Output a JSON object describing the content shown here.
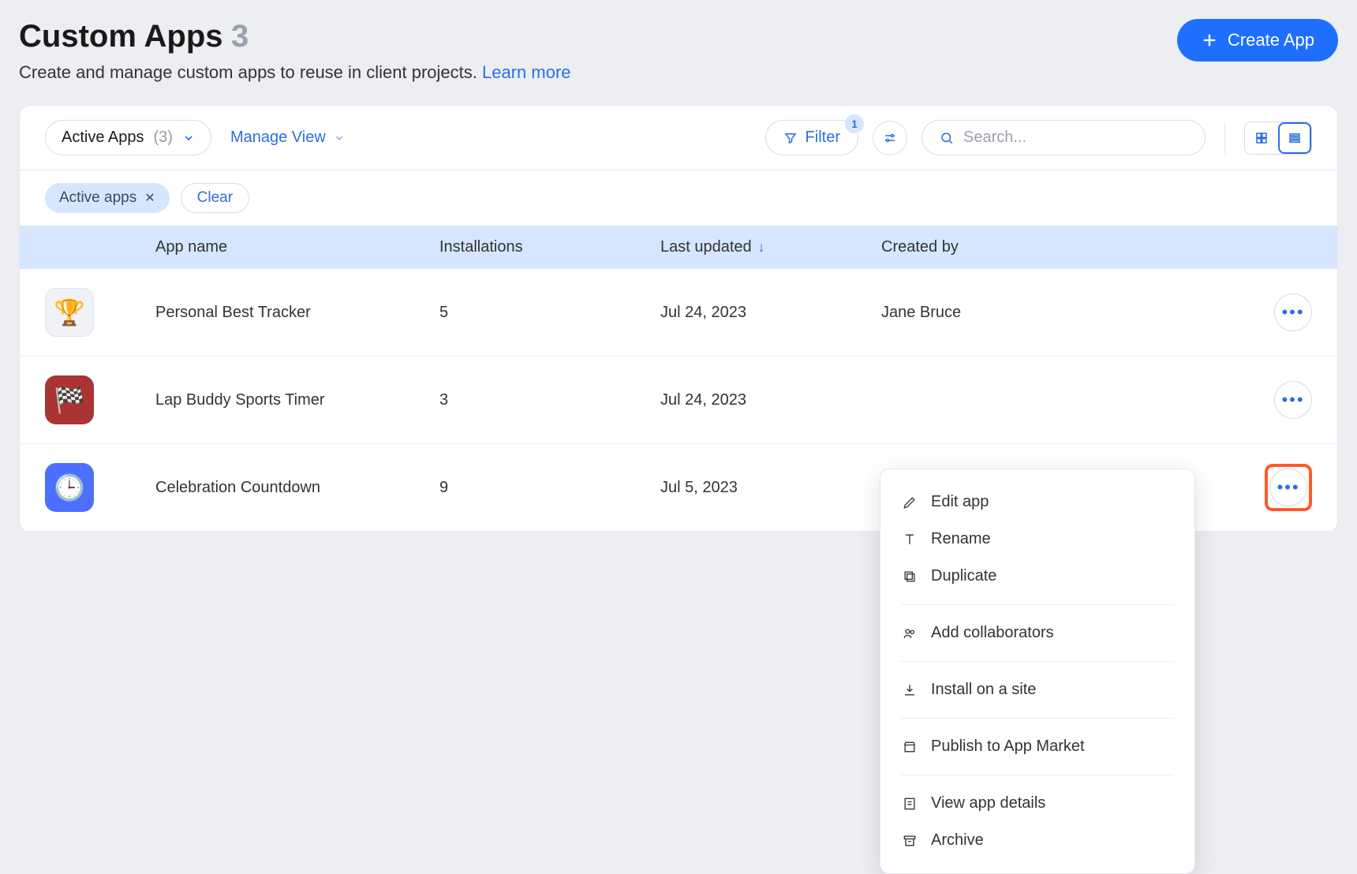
{
  "header": {
    "title": "Custom Apps",
    "count": "3",
    "subtitle": "Create and manage custom apps to reuse in client projects. ",
    "learn_more": "Learn more",
    "create_btn": "Create App"
  },
  "toolbar": {
    "view_name": "Active Apps",
    "view_count": "(3)",
    "manage_view": "Manage View",
    "filter_label": "Filter",
    "filter_count": "1",
    "search_placeholder": "Search..."
  },
  "chips": {
    "active_chip": "Active apps",
    "clear": "Clear"
  },
  "columns": {
    "app_name": "App name",
    "installations": "Installations",
    "last_updated": "Last updated",
    "created_by": "Created by"
  },
  "rows": [
    {
      "name": "Personal Best Tracker",
      "installations": "5",
      "updated": "Jul 24, 2023",
      "creator": "Jane Bruce"
    },
    {
      "name": "Lap Buddy Sports Timer",
      "installations": "3",
      "updated": "Jul 24, 2023",
      "creator": ""
    },
    {
      "name": "Celebration Countdown",
      "installations": "9",
      "updated": "Jul 5, 2023",
      "creator": ""
    }
  ],
  "menu": {
    "edit": "Edit app",
    "rename": "Rename",
    "duplicate": "Duplicate",
    "collaborators": "Add collaborators",
    "install": "Install on a site",
    "publish": "Publish to App Market",
    "details": "View app details",
    "archive": "Archive"
  }
}
